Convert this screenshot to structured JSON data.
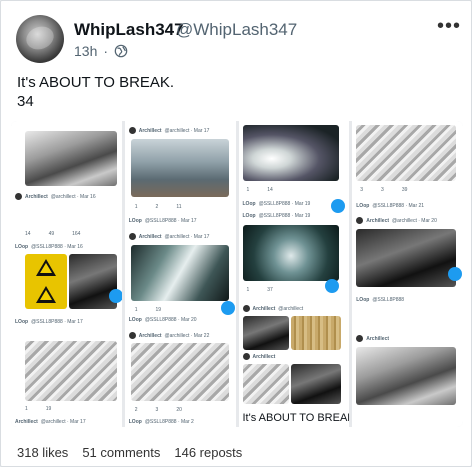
{
  "post": {
    "display_name": "WhipLash347",
    "handle": "@WhipLash347",
    "time": "13h",
    "text": "It's ABOUT TO BREAK.\n34"
  },
  "media_panels": {
    "col1": {
      "post1_author": "Archillect",
      "post1_handle": "@archillect · Mar 16",
      "post1_stats": [
        "14",
        "49",
        "164"
      ],
      "post2_author": "LOop",
      "post2_handle": "@SSLL8P888 · Mar 16",
      "post3_author": "LOop",
      "post3_handle": "@SSLL8P888 · Mar 17",
      "post4_author": "Archillect",
      "post4_handle": "@archillect · Mar 17",
      "post4_stats": [
        "1",
        "",
        "19"
      ]
    },
    "col2": {
      "post1_author": "Archillect",
      "post1_handle": "@archillect · Mar 17",
      "post1_stats": [
        "1",
        "2",
        "11"
      ],
      "post2_author": "LOop",
      "post2_handle": "@SSLL8P888 · Mar 17",
      "post3_author": "Archillect",
      "post3_handle": "@archillect · Mar 17",
      "post3_stats": [
        "1",
        "",
        "19"
      ],
      "post4_author": "LOop",
      "post4_handle": "@SSLL8P888 · Mar 20",
      "post5_author": "Archillect",
      "post5_handle": "@archillect · Mar 22",
      "post5_stats": [
        "2",
        "3",
        "20"
      ],
      "post6_author": "LOop",
      "post6_handle": "@SSLL8P888 · Mar 2"
    },
    "col3": {
      "post1_stats": [
        "1",
        "",
        "14"
      ],
      "post2_author": "LOop",
      "post2_handle": "@SSLL8P888 · Mar 19",
      "post3_author": "LOop",
      "post3_handle": "@SSLL8P888 · Mar 19",
      "post3_stats": [
        "1",
        "",
        "37"
      ],
      "post4_author": "Archillect",
      "post4_handle": "@archillect",
      "post5_author": "Archillect",
      "caption": "It's ABOUT TO BREAK"
    },
    "col4": {
      "post1_stats": [
        "3",
        "3",
        "39"
      ],
      "post2_author": "LOop",
      "post2_handle": "@SSLL8P888 · Mar 21",
      "post3_author": "Archillect",
      "post3_handle": "@archillect · Mar 20",
      "post4_author": "LOop",
      "post4_handle": "@SSLL8P888",
      "post5_author": "Archillect"
    }
  },
  "engagement": {
    "likes": "318 likes",
    "comments": "51 comments",
    "reposts": "146 reposts"
  },
  "colors": {
    "text": "#0f1419",
    "secondary": "#536471",
    "accent": "#1d9bf0"
  }
}
